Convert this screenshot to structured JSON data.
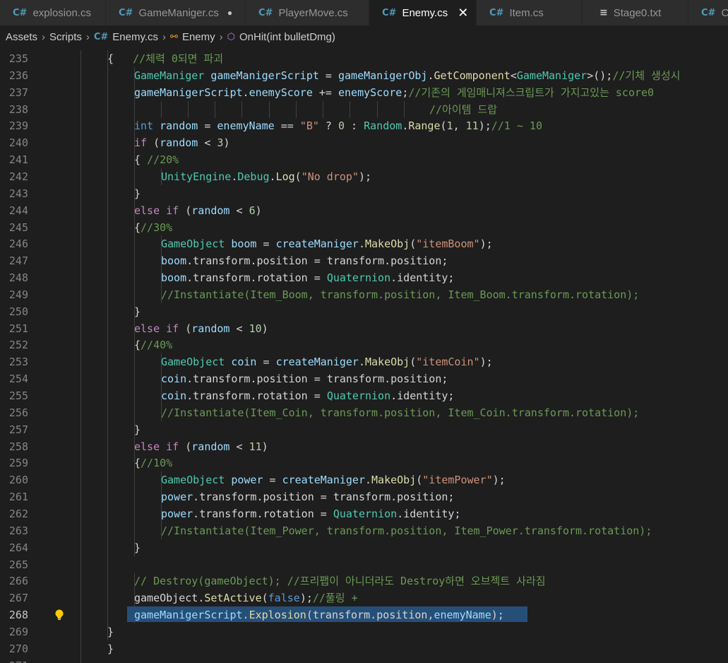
{
  "tabs": [
    {
      "label": "explosion.cs",
      "icon": "csharp-icon"
    },
    {
      "label": "GameManiger.cs",
      "icon": "csharp-icon",
      "modified": true
    },
    {
      "label": "PlayerMove.cs",
      "icon": "csharp-icon"
    },
    {
      "label": "Enemy.cs",
      "icon": "csharp-icon",
      "active": true
    },
    {
      "label": "Item.cs",
      "icon": "csharp-icon"
    },
    {
      "label": "Stage0.txt",
      "icon": "text-file-icon"
    },
    {
      "label": "Cr",
      "icon": "csharp-icon"
    }
  ],
  "breadcrumb": {
    "folder1": "Assets",
    "folder2": "Scripts",
    "file": "Enemy.cs",
    "class": "Enemy",
    "method": "OnHit(int bulletDmg)"
  },
  "editor": {
    "current_line": "268",
    "lines": [
      {
        "n": "235",
        "code": "{   //체력 0되면 파괴"
      },
      {
        "n": "236",
        "code": "    GameManiger gameManigerScript = gameManigerObj.GetComponent<GameManiger>();//기체 생성시"
      },
      {
        "n": "237",
        "code": "    gameManigerScript.enemyScore += enemyScore;//기존의 게임매니져스크립트가 가지고있는 score0"
      },
      {
        "n": "238",
        "code": "                                                //아이템 드랍"
      },
      {
        "n": "239",
        "code": "    int random = enemyName == \"B\" ? 0 : Random.Range(1, 11);//1 ~ 10"
      },
      {
        "n": "240",
        "code": "    if (random < 3)"
      },
      {
        "n": "241",
        "code": "    { //20%"
      },
      {
        "n": "242",
        "code": "        UnityEngine.Debug.Log(\"No drop\");"
      },
      {
        "n": "243",
        "code": "    }"
      },
      {
        "n": "244",
        "code": "    else if (random < 6)"
      },
      {
        "n": "245",
        "code": "    {//30%"
      },
      {
        "n": "246",
        "code": "        GameObject boom = createManiger.MakeObj(\"itemBoom\");"
      },
      {
        "n": "247",
        "code": "        boom.transform.position = transform.position;"
      },
      {
        "n": "248",
        "code": "        boom.transform.rotation = Quaternion.identity;"
      },
      {
        "n": "249",
        "code": "        //Instantiate(Item_Boom, transform.position, Item_Boom.transform.rotation);"
      },
      {
        "n": "250",
        "code": "    }"
      },
      {
        "n": "251",
        "code": "    else if (random < 10)"
      },
      {
        "n": "252",
        "code": "    {//40%"
      },
      {
        "n": "253",
        "code": "        GameObject coin = createManiger.MakeObj(\"itemCoin\");"
      },
      {
        "n": "254",
        "code": "        coin.transform.position = transform.position;"
      },
      {
        "n": "255",
        "code": "        coin.transform.rotation = Quaternion.identity;"
      },
      {
        "n": "256",
        "code": "        //Instantiate(Item_Coin, transform.position, Item_Coin.transform.rotation);"
      },
      {
        "n": "257",
        "code": "    }"
      },
      {
        "n": "258",
        "code": "    else if (random < 11)"
      },
      {
        "n": "259",
        "code": "    {//10%"
      },
      {
        "n": "260",
        "code": "        GameObject power = createManiger.MakeObj(\"itemPower\");"
      },
      {
        "n": "261",
        "code": "        power.transform.position = transform.position;"
      },
      {
        "n": "262",
        "code": "        power.transform.rotation = Quaternion.identity;"
      },
      {
        "n": "263",
        "code": "        //Instantiate(Item_Power, transform.position, Item_Power.transform.rotation);"
      },
      {
        "n": "264",
        "code": "    }"
      },
      {
        "n": "265",
        "code": ""
      },
      {
        "n": "266",
        "code": "    // Destroy(gameObject); //프리팹이 아니더라도 Destroy하면 오브젝트 사라짐"
      },
      {
        "n": "267",
        "code": "    gameObject.SetActive(false);//풀링 +"
      },
      {
        "n": "268",
        "code": "    gameManigerScript.Explosion(transform.position,enemyName);"
      },
      {
        "n": "269",
        "code": "}"
      },
      {
        "n": "270",
        "code": "}"
      },
      {
        "n": "271",
        "code": ""
      }
    ]
  },
  "colors": {
    "background": "#1e1e1e",
    "keyword": "#569cd6",
    "control": "#c586c0",
    "type": "#4ec9b0",
    "string": "#ce9178",
    "number": "#b5cea8",
    "comment": "#6a9955",
    "variable": "#9cdcfe",
    "function": "#dcdcaa",
    "selection": "#264f78"
  }
}
